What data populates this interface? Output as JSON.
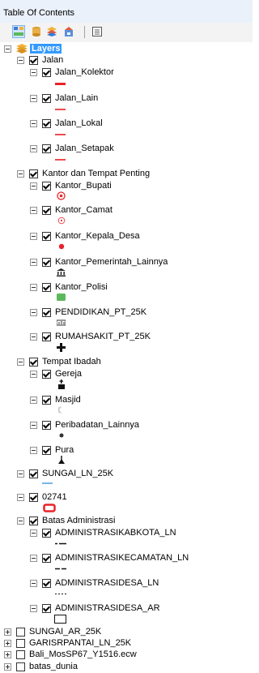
{
  "window": {
    "title": "Table Of Contents"
  },
  "toolbar": {
    "buttons": [
      "list-by-drawing-order",
      "list-by-source",
      "list-by-visibility",
      "list-by-selection",
      "options"
    ]
  },
  "tree": {
    "root": "Layers",
    "groups": {
      "jalan": {
        "name": "Jalan",
        "layers": [
          "Jalan_Kolektor",
          "Jalan_Lain",
          "Jalan_Lokal",
          "Jalan_Setapak"
        ]
      },
      "kantor": {
        "name": "Kantor dan Tempat Penting",
        "layers": [
          "Kantor_Bupati",
          "Kantor_Camat",
          "Kantor_Kepala_Desa",
          "Kantor_Pemerintah_Lainnya",
          "Kantor_Polisi",
          "PENDIDIKAN_PT_25K",
          "RUMAHSAKIT_PT_25K"
        ]
      },
      "ibadah": {
        "name": "Tempat Ibadah",
        "layers": [
          "Gereja",
          "Masjid",
          "Peribadatan_Lainnya",
          "Pura"
        ]
      },
      "sungai": {
        "name": "SUNGAI_LN_25K"
      },
      "kode": {
        "name": "02741"
      },
      "batas": {
        "name": "Batas Administrasi",
        "layers": [
          "ADMINISTRASIKABKOTA_LN",
          "ADMINISTRASIKECAMATAN_LN",
          "ADMINISTRASIDESA_LN",
          "ADMINISTRASIDESA_AR"
        ]
      }
    },
    "collapsed": [
      "SUNGAI_AR_25K",
      "GARISRPANTAI_LN_25K",
      "Bali_MosSP67_Y1516.ecw",
      "batas_dunia"
    ]
  },
  "colors": {
    "selection": "#3399ff",
    "road_red": "#e8232a",
    "river_blue": "#79b6e8",
    "polisi_green": "#5cb85c"
  }
}
